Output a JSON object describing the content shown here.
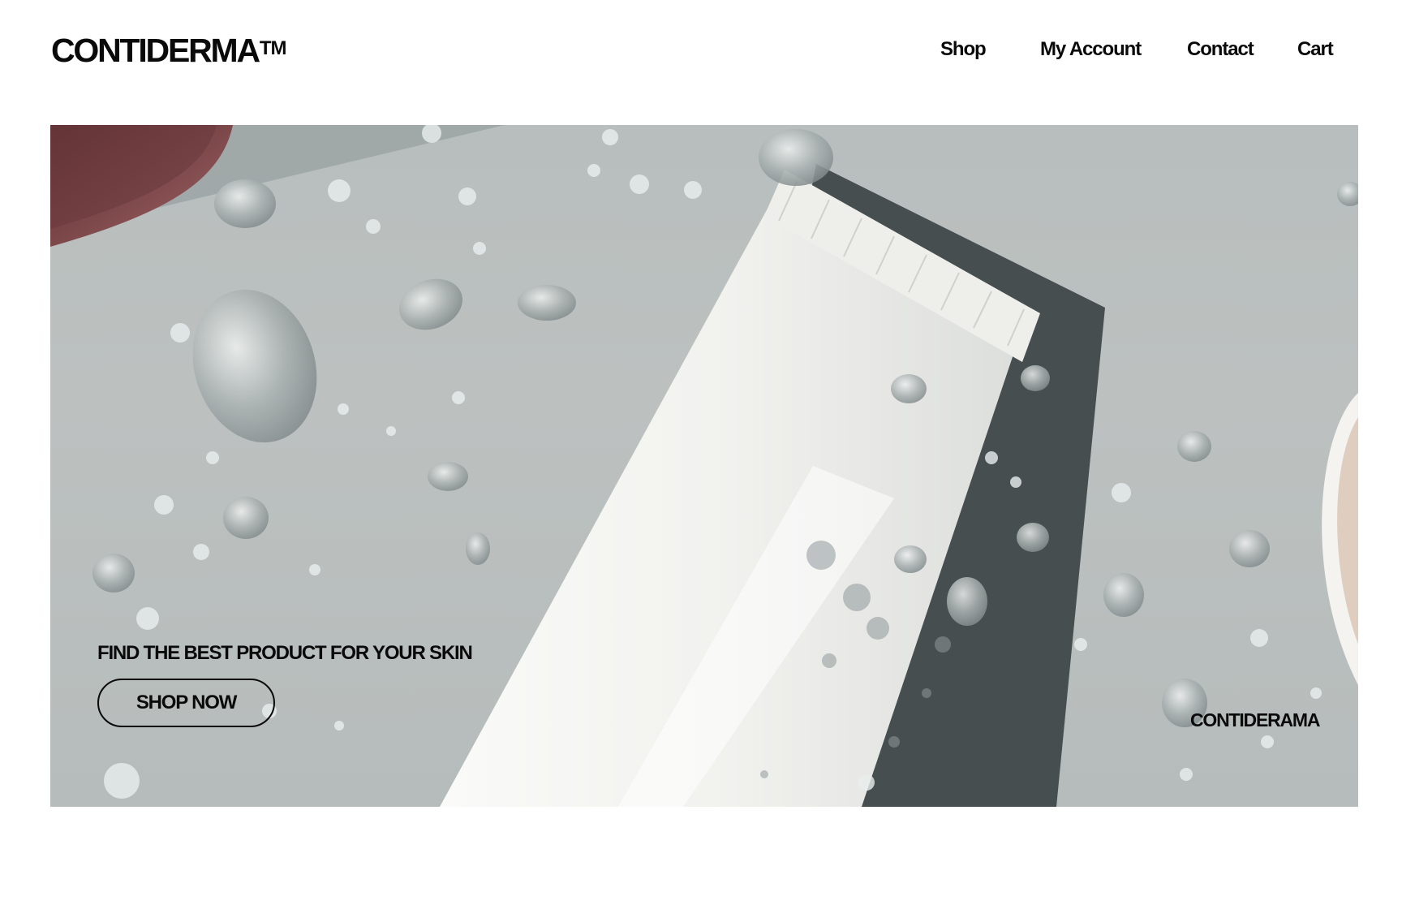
{
  "header": {
    "logo": "CONTIDERMA",
    "logo_mark": "TM",
    "nav": [
      {
        "label": "Shop"
      },
      {
        "label": "My Account"
      },
      {
        "label": "Contact"
      },
      {
        "label": "Cart"
      }
    ]
  },
  "hero": {
    "image": "cream-tube-water-droplets-photo",
    "tagline": "FIND THE BEST PRODUCT FOR YOUR SKIN",
    "cta_label": "SHOP NOW",
    "brand_caption": "CONTIDERAMA"
  },
  "colors": {
    "background": "#ffffff",
    "text": "#0a0a0a",
    "hero_surface": "#b9bfbe",
    "tube": "#f2f2ef",
    "shadow": "#3d4447"
  }
}
